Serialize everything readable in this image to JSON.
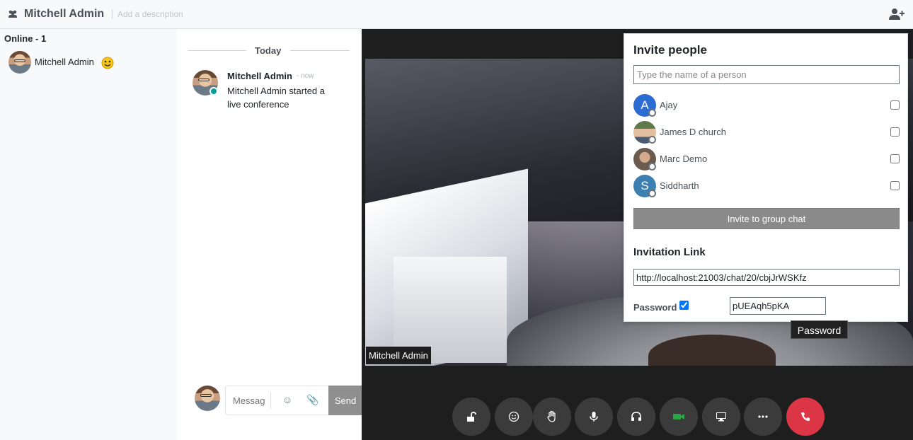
{
  "header": {
    "title": "Mitchell Admin",
    "description_placeholder": "Add a description",
    "group_icon": "users-icon",
    "add_icon": "user-plus-icon"
  },
  "sidebar": {
    "online_title": "Online - 1",
    "members": [
      {
        "name": "Mitchell Admin",
        "emoji": "smiley-icon"
      }
    ]
  },
  "chat": {
    "day_label": "Today",
    "messages": [
      {
        "author": "Mitchell Admin",
        "time": "- now",
        "body": "Mitchell Admin started a live conference"
      }
    ],
    "composer": {
      "placeholder": "Message…",
      "send_label": "Send",
      "emoji_icon": "emoji-icon",
      "attach_icon": "paperclip-icon"
    }
  },
  "video": {
    "participant_name": "Mitchell Admin",
    "controls": [
      {
        "name": "unlock-button",
        "icon": "unlock-icon"
      },
      {
        "name": "emoji-button",
        "icon": "smiley-icon"
      },
      {
        "name": "raise-hand-button",
        "icon": "hand-icon"
      },
      {
        "name": "microphone-button",
        "icon": "microphone-icon"
      },
      {
        "name": "headset-button",
        "icon": "headset-icon"
      },
      {
        "name": "camera-button",
        "icon": "video-camera-icon"
      },
      {
        "name": "screen-share-button",
        "icon": "desktop-icon"
      },
      {
        "name": "more-button",
        "icon": "ellipsis-icon"
      },
      {
        "name": "hang-up-button",
        "icon": "phone-icon"
      }
    ],
    "colors": {
      "camera_active": "#28a745",
      "hangup": "#dc3545",
      "control_bg": "#3b3b3b"
    }
  },
  "invite": {
    "title": "Invite people",
    "search_placeholder": "Type the name of a person",
    "partners": [
      {
        "name": "Ajay",
        "initial": "A",
        "color": "#2c6bd1",
        "checked": false
      },
      {
        "name": "James D church",
        "initial": "",
        "color": "#7d8c74",
        "checked": false
      },
      {
        "name": "Marc Demo",
        "initial": "",
        "color": "#6b5a4e",
        "checked": false
      },
      {
        "name": "Siddharth",
        "initial": "S",
        "color": "#3c7fb0",
        "checked": false
      }
    ],
    "invite_button": "Invite to group chat",
    "link_title": "Invitation Link",
    "link_value": "http://localhost:21003/chat/20/cbjJrWSKfz",
    "password_label": "Password",
    "password_enabled": true,
    "password_value": "pUEAqh5pKA"
  },
  "tooltip": {
    "text": "Password"
  }
}
